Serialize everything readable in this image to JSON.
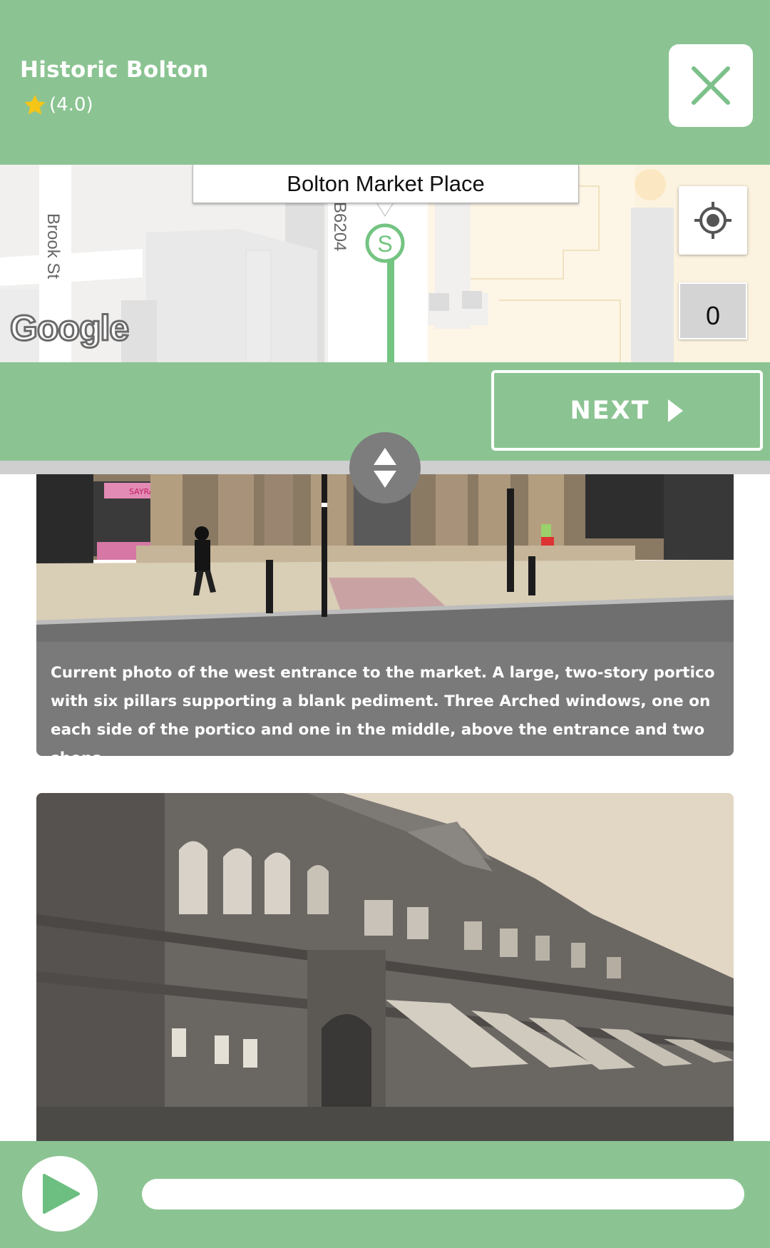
{
  "header": {
    "title": "Historic Bolton",
    "rating_text": "(4.0)",
    "rating_value": 4.0,
    "close_icon": "close-icon"
  },
  "map": {
    "place_label": "Bolton Market Place",
    "street_labels": [
      "Brook St",
      "B6204"
    ],
    "marker_letter": "S",
    "counter": "0",
    "attribution": "Google",
    "locate_icon": "crosshair-icon"
  },
  "navigation": {
    "next_label": "NEXT"
  },
  "content": {
    "caption": "Current photo of the west entrance to the market. A large, two-story portico with six pillars supporting a blank pediment. Three Arched windows, one on each side of the portico and one in the middle, above the entrance and two shops.",
    "shop_sign": "SAYRA'S"
  },
  "player": {
    "progress": 0
  },
  "colors": {
    "brand_green": "#8bc492",
    "route_green": "#74c482",
    "caption_gray": "#7a7a7a",
    "star_yellow": "#f5c518"
  }
}
